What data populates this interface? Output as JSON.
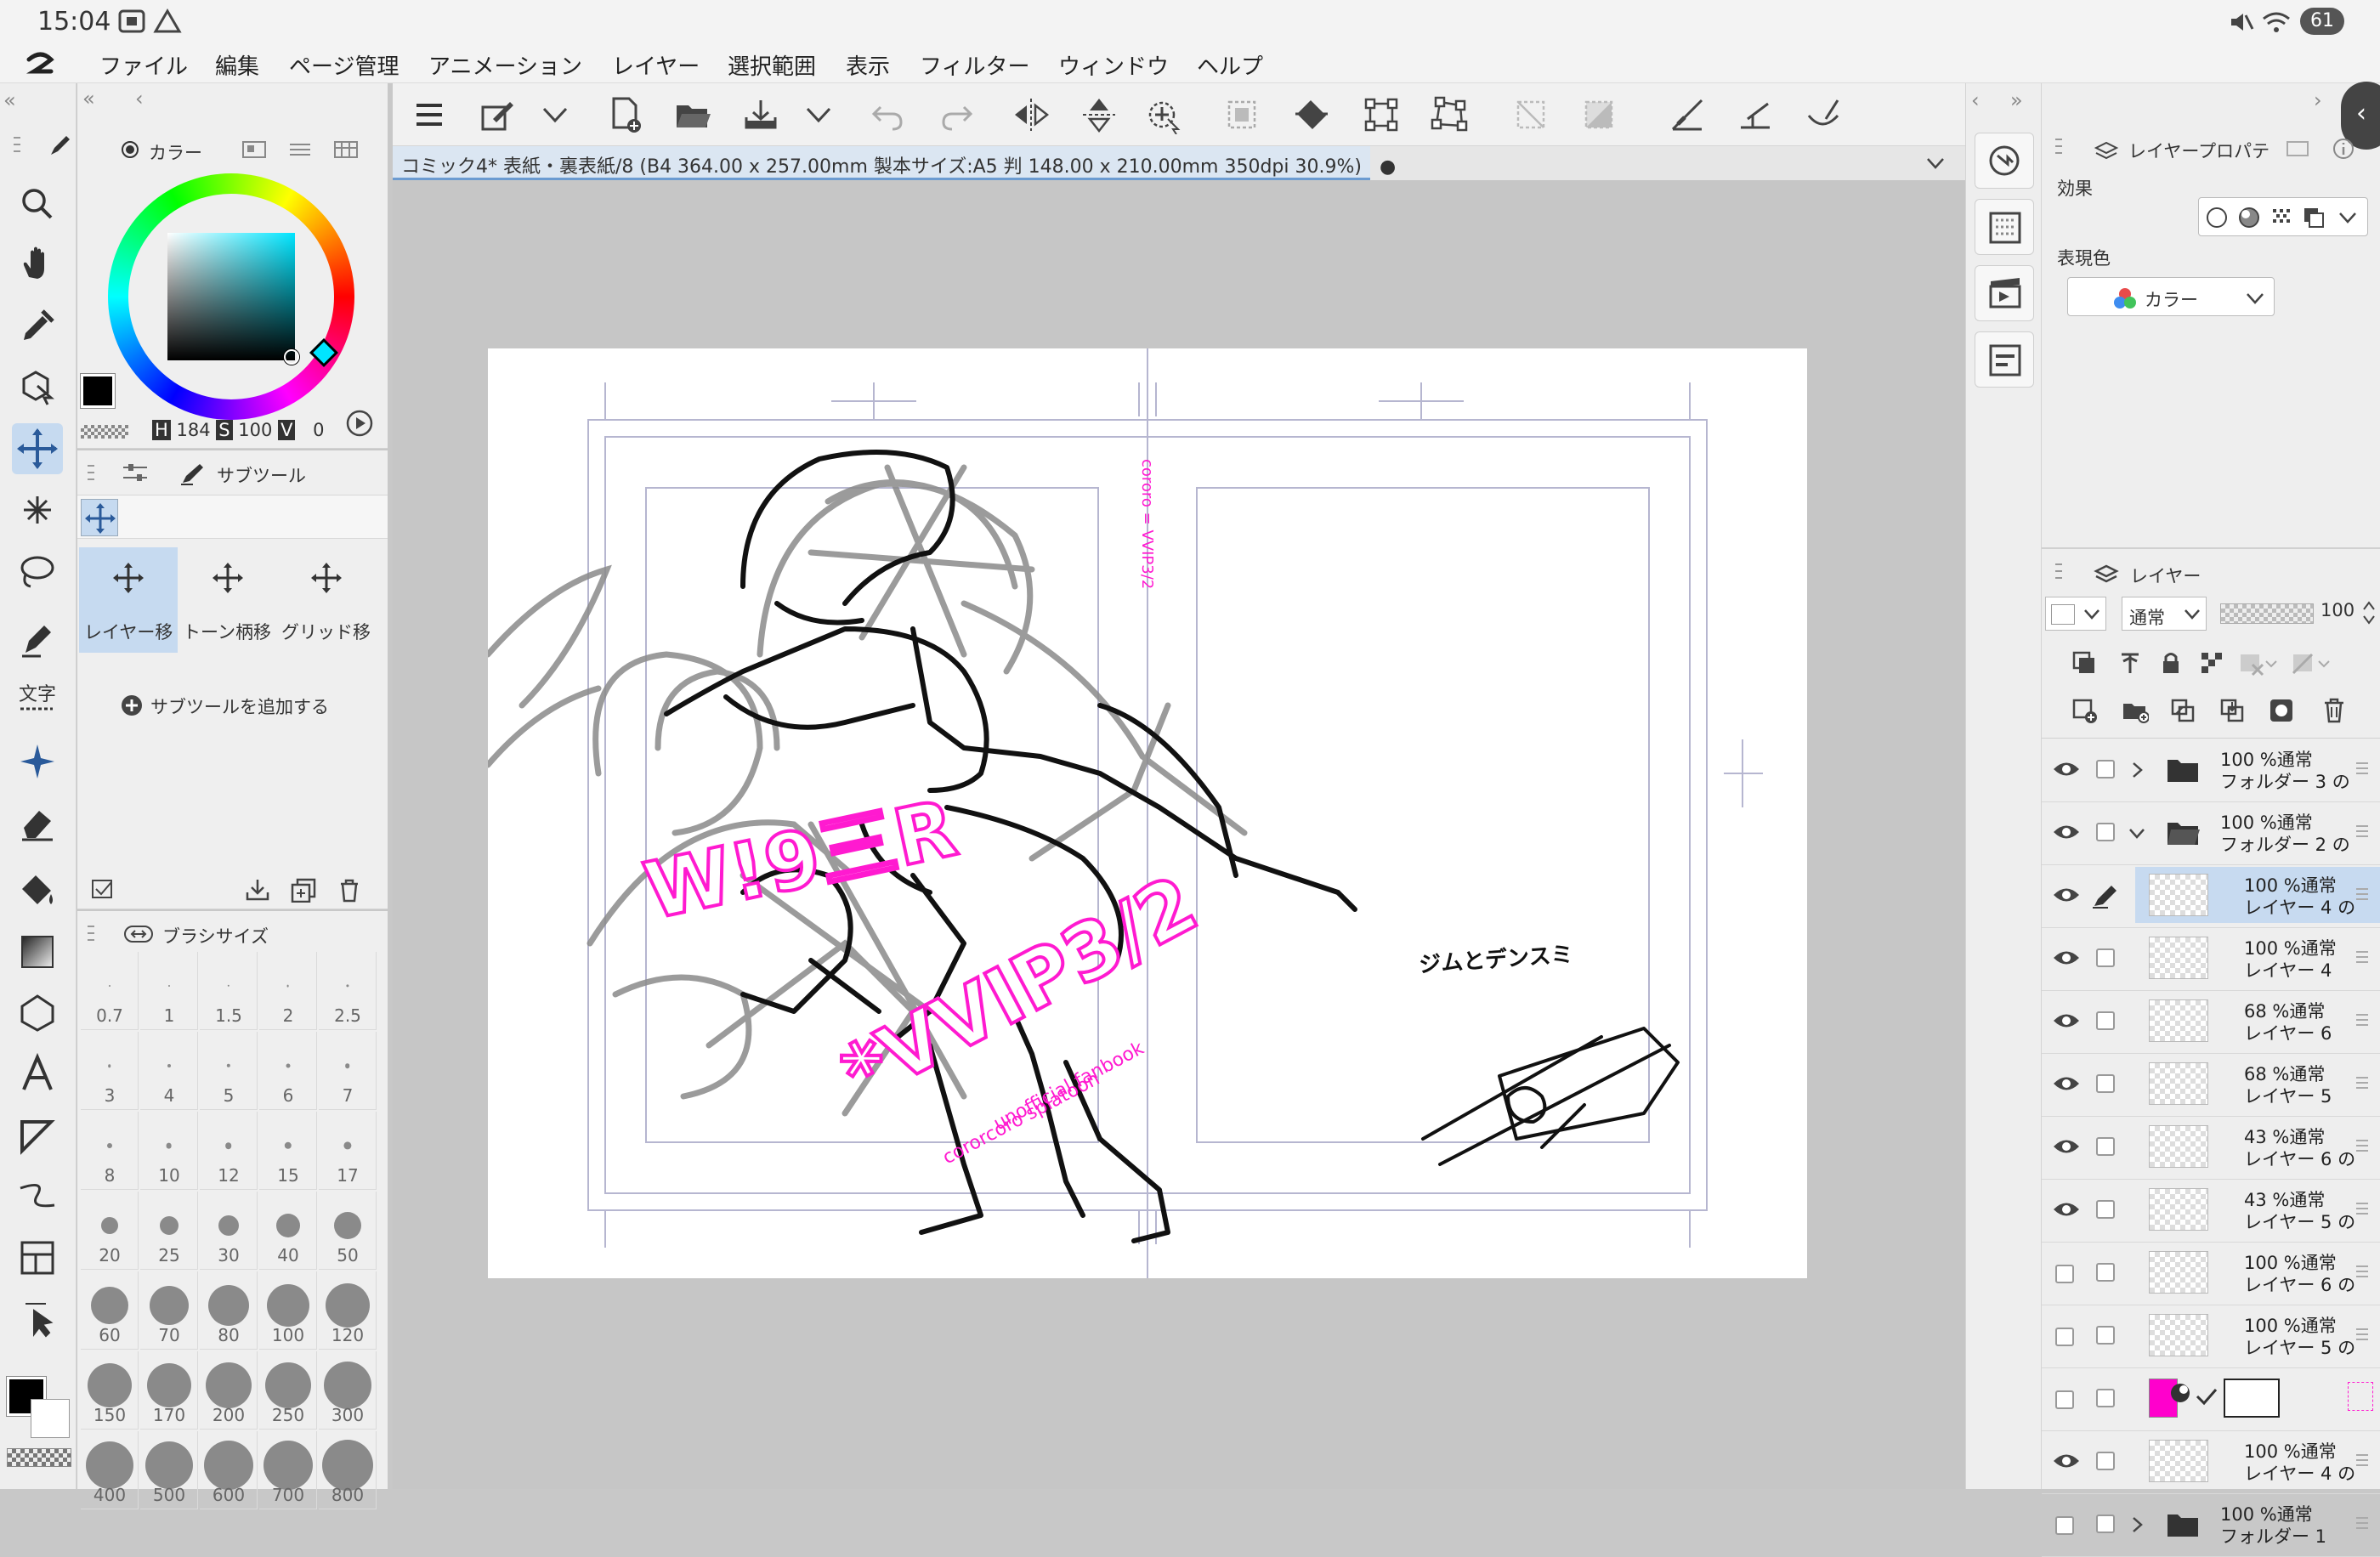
{
  "status_bar": {
    "time": "15:04",
    "battery": "61"
  },
  "menu": [
    "ファイル",
    "編集",
    "ページ管理",
    "アニメーション",
    "レイヤー",
    "選択範囲",
    "表示",
    "フィルター",
    "ウィンドウ",
    "ヘルプ"
  ],
  "color_panel": {
    "tab_label": "カラー",
    "h_label": "H",
    "h_value": "184",
    "s_label": "S",
    "s_value": "100",
    "v_label": "V",
    "v_value": "0"
  },
  "subtool_panel": {
    "tab_label": "サブツール",
    "tools": [
      "レイヤー移",
      "トーン柄移",
      "グリッド移"
    ],
    "add_label": "サブツールを追加する"
  },
  "brush_panel": {
    "tab_label": "ブラシサイズ",
    "sizes": [
      "0.7",
      "1",
      "1.5",
      "2",
      "2.5",
      "3",
      "4",
      "5",
      "6",
      "7",
      "8",
      "10",
      "12",
      "15",
      "17",
      "20",
      "25",
      "30",
      "40",
      "50",
      "60",
      "70",
      "80",
      "100",
      "120",
      "150",
      "170",
      "200",
      "250",
      "300",
      "400",
      "500",
      "600",
      "700",
      "800"
    ]
  },
  "document": {
    "tab_title": "コミック4* 表紙・裏表紙/8 (B4 364.00 x 257.00mm 製本サイズ:A5 判 148.00 x 210.00mm 350dpi 30.9%)"
  },
  "canvas_text": {
    "logo_main": "W!9三R",
    "logo_sub": "*VVIP3/2",
    "logo_caption1": "cororcoro splatoon",
    "logo_caption2": "unofficial fanbook",
    "note": "ジムとデンスミ",
    "spine": "cororo = VVIP3/2"
  },
  "layer_property": {
    "tab_label": "レイヤープロパテ",
    "effect_label": "効果",
    "color_label": "表現色",
    "color_value": "カラー"
  },
  "layer_panel": {
    "tab_label": "レイヤー",
    "blend_mode": "通常",
    "opacity": "100",
    "rows": [
      {
        "op": "100 %通常",
        "name": "フォルダー 3 の",
        "kind": "folder",
        "expanded": false,
        "visible": true
      },
      {
        "op": "100 %通常",
        "name": "フォルダー 2 の",
        "kind": "folder",
        "expanded": true,
        "visible": true
      },
      {
        "op": "100 %通常",
        "name": "レイヤー 4 の",
        "kind": "layer",
        "selected": true,
        "visible": true
      },
      {
        "op": "100 %通常",
        "name": "レイヤー 4",
        "kind": "layer",
        "visible": true
      },
      {
        "op": "68 %通常",
        "name": "レイヤー 6",
        "kind": "layer",
        "visible": true
      },
      {
        "op": "68 %通常",
        "name": "レイヤー 5",
        "kind": "layer",
        "visible": true
      },
      {
        "op": "43 %通常",
        "name": "レイヤー 6 の",
        "kind": "layer",
        "visible": true
      },
      {
        "op": "43 %通常",
        "name": "レイヤー 5 の",
        "kind": "layer",
        "visible": true
      },
      {
        "op": "100 %通常",
        "name": "レイヤー 6 の",
        "kind": "layer",
        "visible": false
      },
      {
        "op": "100 %通常",
        "name": "レイヤー 5 の",
        "kind": "layer",
        "visible": false
      },
      {
        "op": "",
        "name": "",
        "kind": "paper",
        "visible": false
      },
      {
        "op": "100 %通常",
        "name": "レイヤー 4 の",
        "kind": "layer",
        "visible": true
      },
      {
        "op": "100 %通常",
        "name": "フォルダー 1",
        "kind": "folder",
        "expanded": false,
        "visible": false
      }
    ]
  },
  "colors": {
    "accent": "#6b9bd1",
    "magenta": "#ff1ad0",
    "selected_row": "#c7daf0"
  }
}
